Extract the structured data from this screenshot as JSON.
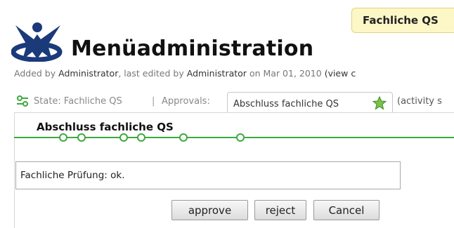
{
  "header": {
    "status_badge": "Fachliche QS",
    "page_title": "Menüadministration"
  },
  "meta": {
    "added_by_prefix": "Added by",
    "added_by_user": "Administrator",
    "edited_prefix": ", last edited by",
    "edited_by_user": "Administrator",
    "date_text": "on Mar 01, 2010",
    "view_link": "(view c"
  },
  "workflow": {
    "state_text": "State: Fachliche QS",
    "separator": "|",
    "approvals_label": "Approvals:",
    "approval_tab_label": "Abschluss fachliche QS",
    "activity_text": "(activity s",
    "step_title": "Abschluss fachliche QS"
  },
  "comment": {
    "value": "Fachliche Prüfung: ok."
  },
  "buttons": {
    "approve": "approve",
    "reject": "reject",
    "cancel": "Cancel"
  },
  "colors": {
    "accent_green": "#3daa3d",
    "badge_background": "#fdf7c8",
    "logo_blue": "#1a3a7a"
  }
}
